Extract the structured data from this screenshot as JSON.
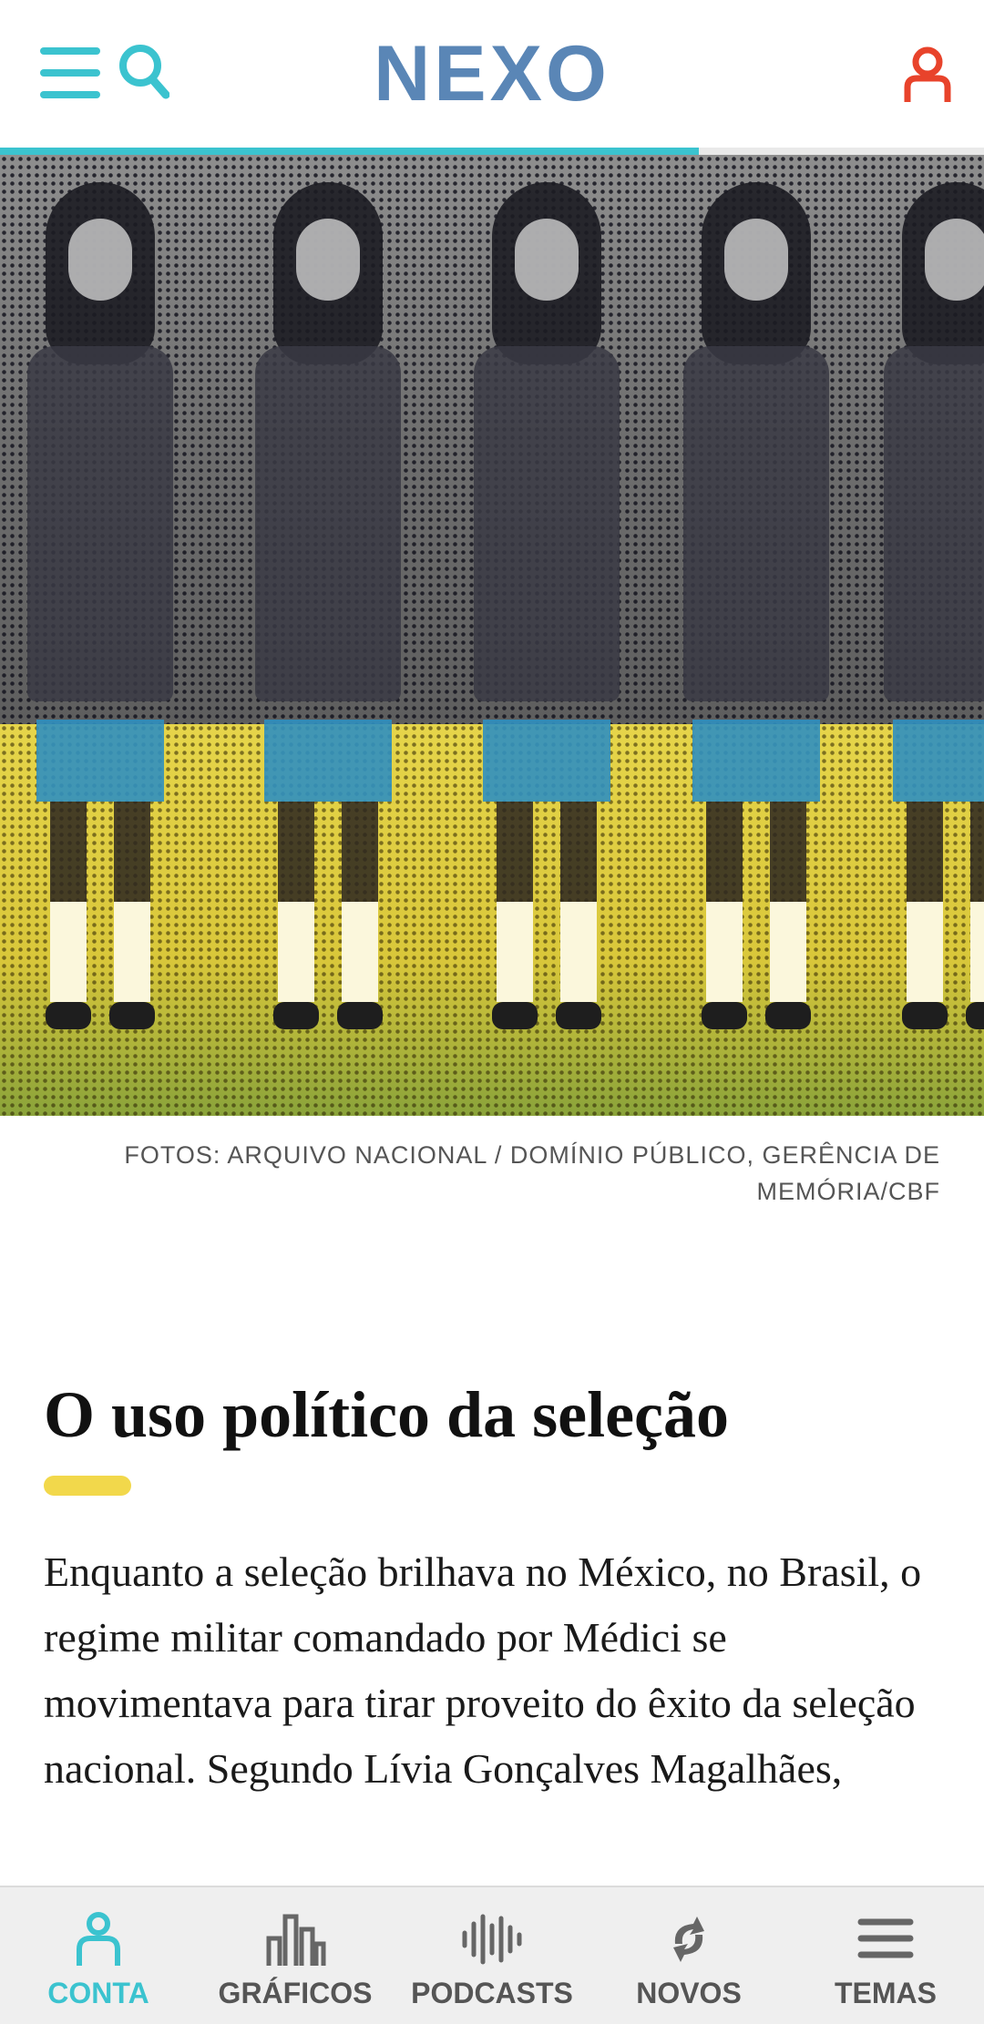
{
  "header": {
    "logo_text": "NEXO",
    "progress_fraction": 0.71
  },
  "colors": {
    "accent": "#3bc3cf",
    "user": "#e8432b",
    "highlight": "#f2d84b"
  },
  "hero": {
    "caption": "FOTOS: ARQUIVO NACIONAL / DOMÍNIO PÚBLICO, GERÊNCIA DE MEMÓRIA/CBF"
  },
  "article": {
    "headline": "O uso político da seleção",
    "body": "Enquanto a seleção brilhava no México, no Brasil, o regime militar comandado por Médici se movimentava para tirar proveito do êxito da seleção nacional. Segundo Lívia Gonçalves Magalhães,"
  },
  "bottom_nav": {
    "items": [
      {
        "label": "CONTA",
        "icon": "user-icon",
        "active": true
      },
      {
        "label": "GRÁFICOS",
        "icon": "bar-chart-icon",
        "active": false
      },
      {
        "label": "PODCASTS",
        "icon": "audio-wave-icon",
        "active": false
      },
      {
        "label": "NOVOS",
        "icon": "refresh-icon",
        "active": false
      },
      {
        "label": "TEMAS",
        "icon": "menu-icon",
        "active": false
      }
    ]
  }
}
